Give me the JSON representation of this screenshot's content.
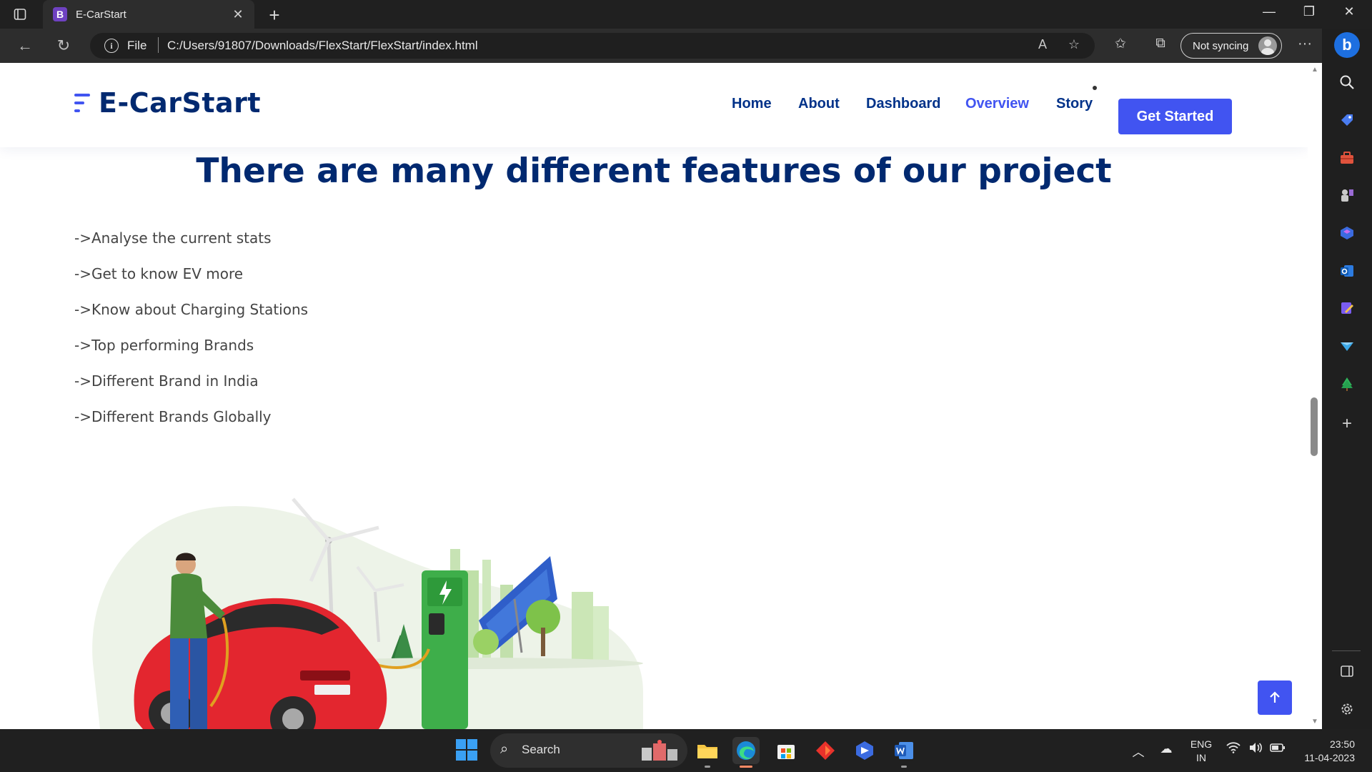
{
  "browser": {
    "tab_title": "E-CarStart",
    "tab_favicon": "B",
    "tab_close": "✕",
    "new_tab": "+",
    "window_controls": {
      "minimize": "—",
      "maximize": "❐",
      "close": "✕"
    },
    "url_scheme": "File",
    "url": "C:/Users/91807/Downloads/FlexStart/FlexStart/index.html",
    "sync_label": "Not syncing",
    "more_label": "···",
    "bing_label": "b"
  },
  "site": {
    "logo_text": "E-CarStart",
    "nav": [
      {
        "label": "Home",
        "active": false
      },
      {
        "label": "About",
        "active": false
      },
      {
        "label": "Dashboard",
        "active": false
      },
      {
        "label": "Overview",
        "active": true
      },
      {
        "label": "Story",
        "active": false
      }
    ],
    "cta_label": "Get Started",
    "section_title": "There are many different features of our project",
    "features": [
      "->Analyse the current stats",
      "->Get to know EV more",
      "->Know about Charging Stations",
      "->Top performing Brands",
      "->Different Brand in India",
      "->Different Brands Globally"
    ],
    "back_to_top_icon": "arrow-up-icon"
  },
  "taskbar": {
    "search_label": "Search",
    "lang_line1": "ENG",
    "lang_line2": "IN",
    "time": "23:50",
    "date": "11-04-2023"
  },
  "colors": {
    "brand": "#4154f1",
    "heading": "#012970",
    "nav": "#013289",
    "text": "#444444"
  }
}
